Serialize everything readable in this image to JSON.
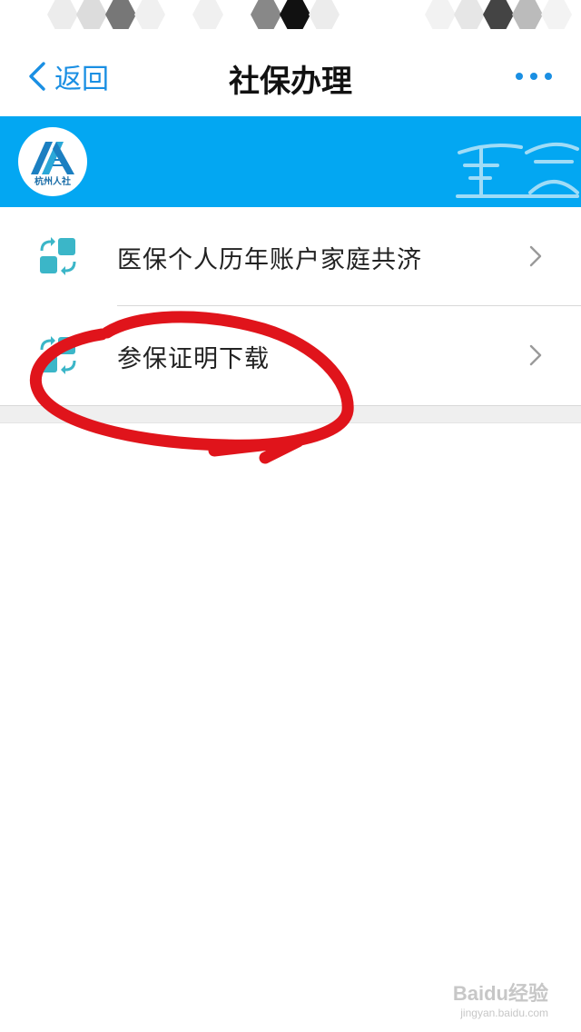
{
  "nav": {
    "back_label": "返回",
    "title": "社保办理"
  },
  "banner": {
    "logo_text": "杭州人社"
  },
  "list": {
    "items": [
      {
        "label": "医保个人历年账户家庭共济"
      },
      {
        "label": "参保证明下载"
      }
    ]
  },
  "watermark": {
    "main": "Baidu经验",
    "sub": "jingyan.baidu.com"
  },
  "colors": {
    "accent": "#1a8fe3",
    "banner": "#03a7f2",
    "icon_teal": "#3bb6c8",
    "annotation": "#e0141b"
  }
}
